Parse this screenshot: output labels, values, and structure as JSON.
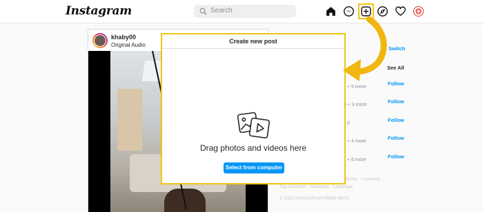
{
  "header": {
    "logo": "Instagram",
    "search_placeholder": "Search",
    "icons": [
      "home-icon",
      "messenger-icon",
      "create-post-icon",
      "explore-icon",
      "heart-icon",
      "profile-avatar"
    ]
  },
  "post": {
    "username": "khaby00",
    "audio": "Original Audio"
  },
  "sidebar": {
    "switch_label": "Switch",
    "see_all_label": "See All",
    "suggestions": [
      {
        "snippet": "+ 5 more",
        "follow": "Follow"
      },
      {
        "snippet": "o + 3 more",
        "follow": "Follow"
      },
      {
        "snippet": "d",
        "follow": "Follow"
      },
      {
        "snippet": "+ 4 more",
        "follow": "Follow"
      },
      {
        "snippet": "+ 6 more",
        "follow": "Follow"
      }
    ],
    "footer_line1": "rivacy · Terms · Locations ·",
    "footer_line2": "Top Accounts · Hashtags · Language",
    "copyright": "© 2022 INSTAGRAM FROM META"
  },
  "modal": {
    "title": "Create new post",
    "drag_text": "Drag photos and videos here",
    "select_button": "Select from computer"
  },
  "colors": {
    "accent": "#0095f6",
    "highlight": "#f1c40f",
    "arrow": "#f1b60f"
  }
}
